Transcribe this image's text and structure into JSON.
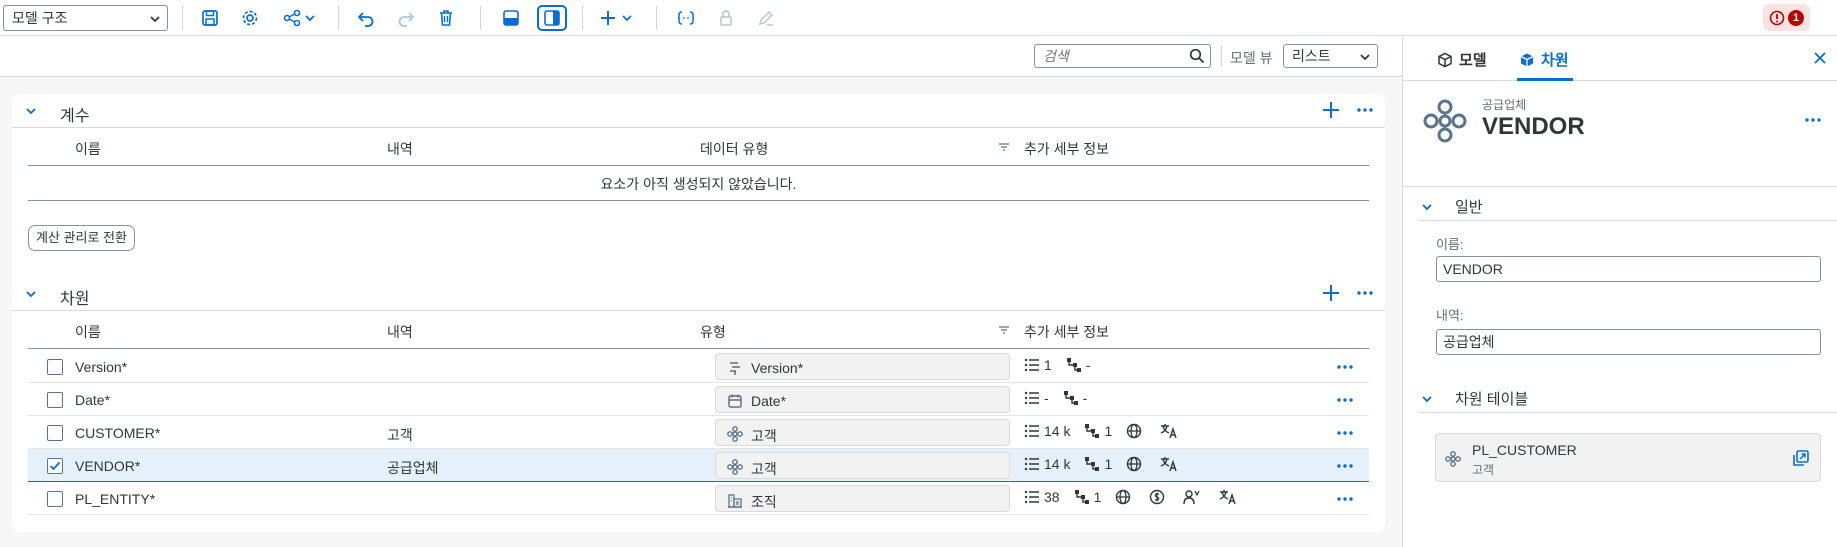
{
  "toolbar": {
    "model_select": "모델 구조",
    "error_count": "1"
  },
  "search": {
    "placeholder": "검색"
  },
  "view": {
    "label": "모델 뷰",
    "selected": "리스트"
  },
  "measures": {
    "title": "계수",
    "columns": [
      "이름",
      "내역",
      "데이터 유형",
      "추가 세부 정보"
    ],
    "empty_message": "요소가 아직 생성되지 않았습니다.",
    "switch_button": "계산 관리로 전환"
  },
  "dimensions": {
    "title": "차원",
    "columns": [
      "이름",
      "내역",
      "유형",
      "추가 세부 정보"
    ],
    "rows": [
      {
        "name": "Version*",
        "desc": "",
        "type": "Version*",
        "members": "1",
        "hierarchies": "-"
      },
      {
        "name": "Date*",
        "desc": "",
        "type": "Date*",
        "members": "-",
        "hierarchies": "-"
      },
      {
        "name": "CUSTOMER*",
        "desc": "고객",
        "type": "고객",
        "members": "14 k",
        "hierarchies": "1"
      },
      {
        "name": "VENDOR*",
        "desc": "공급업체",
        "type": "고객",
        "members": "14 k",
        "hierarchies": "1"
      },
      {
        "name": "PL_ENTITY*",
        "desc": "",
        "type": "조직",
        "members": "38",
        "hierarchies": "1"
      }
    ]
  },
  "panel": {
    "tabs": [
      "모델",
      "차원"
    ],
    "subtitle": "공급업체",
    "title": "VENDOR",
    "general_section": "일반",
    "name_label": "이름:",
    "name_value": "VENDOR",
    "desc_label": "내역:",
    "desc_value": "공급업체",
    "tables_section": "차원 테이블",
    "table_name": "PL_CUSTOMER",
    "table_desc": "고객"
  },
  "colors": {
    "accent": "#0a6ed1",
    "error": "#bb0000",
    "selected_row": "#e5f0fa"
  }
}
